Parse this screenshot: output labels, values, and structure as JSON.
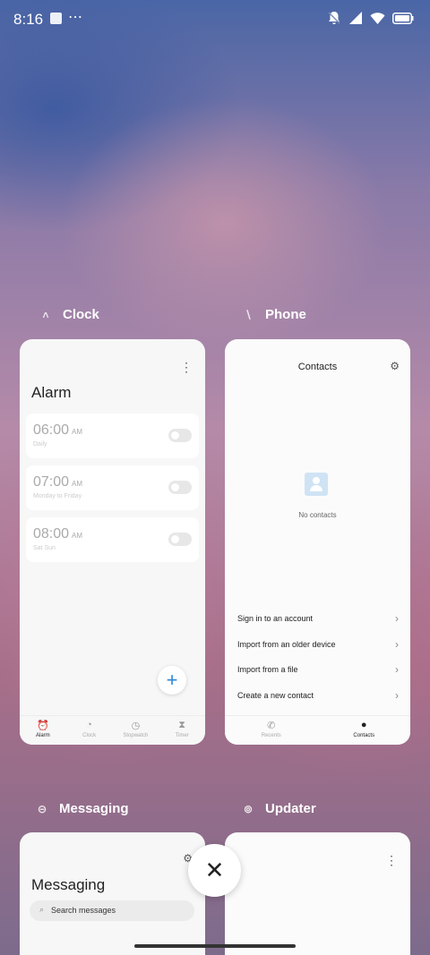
{
  "status": {
    "time": "8:16",
    "dots": "⋯"
  },
  "recents": {
    "clock": {
      "label": "Clock",
      "title": "Alarm",
      "alarms": [
        {
          "time": "06:00",
          "ampm": "AM",
          "repeat": "Daily"
        },
        {
          "time": "07:00",
          "ampm": "AM",
          "repeat": "Monday to Friday"
        },
        {
          "time": "08:00",
          "ampm": "AM",
          "repeat": "Sat Sun"
        }
      ],
      "add": "+",
      "tabs": [
        "Alarm",
        "Clock",
        "Stopwatch",
        "Timer"
      ]
    },
    "phone": {
      "label": "Phone",
      "title": "Contacts",
      "empty_text": "No contacts",
      "rows": [
        "Sign in to an account",
        "Import from an older device",
        "Import from a file",
        "Create a new contact"
      ],
      "tabs": [
        "Recents",
        "Contacts"
      ]
    },
    "messaging": {
      "label": "Messaging",
      "title": "Messaging",
      "search_placeholder": "Search messages"
    },
    "updater": {
      "label": "Updater"
    }
  },
  "close": "✕"
}
